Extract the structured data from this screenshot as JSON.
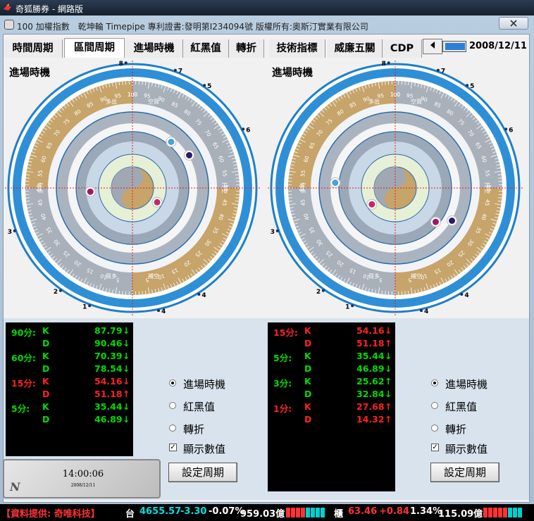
{
  "window": {
    "title": "奇狐勝券 - 網路版",
    "subtitle": "100 加權指數　乾坤輪 Timepipe 專利證書:發明第I234094號 版權所有:奧斯汀實業有限公司",
    "close_label": "關閉"
  },
  "tabs": [
    {
      "label": "時間周期",
      "active": false
    },
    {
      "label": "區間周期",
      "active": true
    },
    {
      "label": "進場時機",
      "active": false
    },
    {
      "label": "紅黑值",
      "active": false
    },
    {
      "label": "轉折",
      "active": false
    },
    {
      "label": "技術指標",
      "active": false
    },
    {
      "label": "威廉五關",
      "active": false
    },
    {
      "label": "CDP",
      "active": false
    }
  ],
  "tab_scroll_icon": "left-arrow-icon",
  "date": "2008/12/11",
  "dials": [
    {
      "title": "進場時機",
      "top_labels": [
        "多出",
        "空買"
      ],
      "bottom_labels": [
        "買多",
        "補空"
      ],
      "left_label": "多持",
      "right_label": "持空",
      "scale_top": [
        "5",
        "10",
        "15",
        "20",
        "25",
        "30",
        "35",
        "40",
        "45",
        "50",
        "55",
        "60",
        "65",
        "70",
        "75",
        "80",
        "85",
        "90",
        "95",
        "100"
      ],
      "markers": [
        {
          "color": "#4aa0d8",
          "angle": 40,
          "ring": 0.57
        },
        {
          "color": "#2a1a6a",
          "angle": 60,
          "ring": 0.62
        },
        {
          "color": "#9a1a6a",
          "angle": 265,
          "ring": 0.4
        },
        {
          "color": "#cc2266",
          "angle": 120,
          "ring": 0.27
        }
      ],
      "outer_numbers": [
        "1",
        "2",
        "3",
        "4",
        "4",
        "6",
        "7",
        "8",
        "5"
      ]
    },
    {
      "title": "進場時機",
      "top_labels": [
        "多出",
        "空買"
      ],
      "bottom_labels": [
        "買多",
        "補空"
      ],
      "left_label": "多持",
      "right_label": "持空",
      "scale_top": [
        "5",
        "10",
        "15",
        "20",
        "25",
        "30",
        "35",
        "40",
        "45",
        "50",
        "55",
        "60",
        "65",
        "70",
        "75",
        "80",
        "85",
        "90",
        "95",
        "100"
      ],
      "markers": [
        {
          "color": "#4aa0d8",
          "angle": 275,
          "ring": 0.57
        },
        {
          "color": "#2a1a6a",
          "angle": 120,
          "ring": 0.62
        },
        {
          "color": "#9a1a6a",
          "angle": 130,
          "ring": 0.5
        },
        {
          "color": "#cc2266",
          "angle": 235,
          "ring": 0.27
        }
      ],
      "outer_numbers": [
        "1",
        "2",
        "3",
        "4",
        "4",
        "6",
        "7",
        "8",
        "5"
      ]
    }
  ],
  "left_values": [
    {
      "period": "90分:",
      "k": "87.79",
      "d": "90.46",
      "period_color": "#00dd00",
      "k_color": "#00dd00",
      "d_color": "#00dd00",
      "k_arrow": "↓",
      "d_arrow": "↓"
    },
    {
      "period": "60分:",
      "k": "70.39",
      "d": "78.54",
      "period_color": "#00dd00",
      "k_color": "#00dd00",
      "d_color": "#00dd00",
      "k_arrow": "↓",
      "d_arrow": "↓"
    },
    {
      "period": "15分:",
      "k": "54.16",
      "d": "51.18",
      "period_color": "#ff2222",
      "k_color": "#ff2222",
      "d_color": "#ff2222",
      "k_arrow": "↓",
      "d_arrow": "↑"
    },
    {
      "period": "5分:",
      "k": "35.44",
      "d": "46.89",
      "period_color": "#00dd00",
      "k_color": "#00dd00",
      "d_color": "#00dd00",
      "k_arrow": "↓",
      "d_arrow": "↓"
    }
  ],
  "right_values": [
    {
      "period": "15分:",
      "k": "54.16",
      "d": "51.18",
      "period_color": "#ff2222",
      "k_color": "#ff2222",
      "d_color": "#ff2222",
      "k_arrow": "↓",
      "d_arrow": "↑"
    },
    {
      "period": "5分:",
      "k": "35.44",
      "d": "46.89",
      "period_color": "#00dd00",
      "k_color": "#00dd00",
      "d_color": "#00dd00",
      "k_arrow": "↓",
      "d_arrow": "↓"
    },
    {
      "period": "3分:",
      "k": "25.62",
      "d": "32.84",
      "period_color": "#00dd00",
      "k_color": "#00dd00",
      "d_color": "#00dd00",
      "k_arrow": "↑",
      "d_arrow": "↓"
    },
    {
      "period": "1分:",
      "k": "27.68",
      "d": "14.32",
      "period_color": "#ff2222",
      "k_color": "#ff2222",
      "d_color": "#ff2222",
      "k_arrow": "↑",
      "d_arrow": "↑"
    }
  ],
  "k_label": "K",
  "d_label": "D",
  "options_left": {
    "radio1": "進場時機",
    "radio2": "紅黑值",
    "radio3": "轉折",
    "check": "顯示數值",
    "button": "設定周期"
  },
  "options_right": {
    "radio1": "進場時機",
    "radio2": "紅黑值",
    "radio3": "轉折",
    "check": "顯示數值",
    "button": "設定周期"
  },
  "clock": {
    "time": "14:00:06",
    "date": "2008/12/11",
    "logo": "N"
  },
  "ticker": {
    "source": "【資料提供: 奇唯科技】",
    "tw_label": "台",
    "tw_index": "4655.57",
    "tw_change": "-3.30",
    "tw_pct": "-0.07%",
    "tw_volume": "959.03億",
    "otc_label": "櫃",
    "otc_index": "63.46",
    "otc_change": "+0.84",
    "otc_pct": "1.34%",
    "otc_volume": "115.09億"
  }
}
